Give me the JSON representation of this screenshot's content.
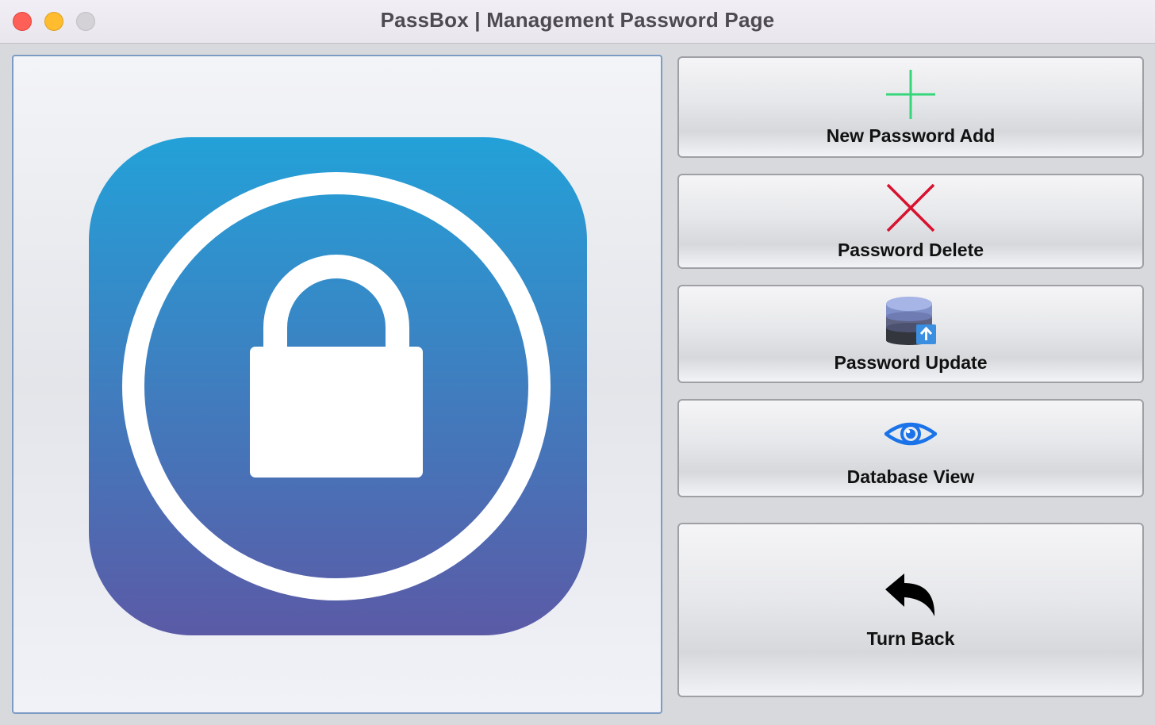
{
  "window": {
    "title": "PassBox | Management Password Page"
  },
  "logo": {
    "icon": "padlock-app-icon",
    "gradient_top": "#23a1d8",
    "gradient_bottom": "#5b5aa6"
  },
  "actions": {
    "add": {
      "label": "New Password Add",
      "icon": "plus-icon",
      "color": "#35d67a"
    },
    "delete": {
      "label": "Password Delete",
      "icon": "x-icon",
      "color": "#d8112e"
    },
    "update": {
      "label": "Password Update",
      "icon": "database-upload-icon"
    },
    "view": {
      "label": "Database View",
      "icon": "eye-icon",
      "color": "#1a73e8"
    },
    "back": {
      "label": "Turn Back",
      "icon": "reply-arrow-icon"
    }
  }
}
